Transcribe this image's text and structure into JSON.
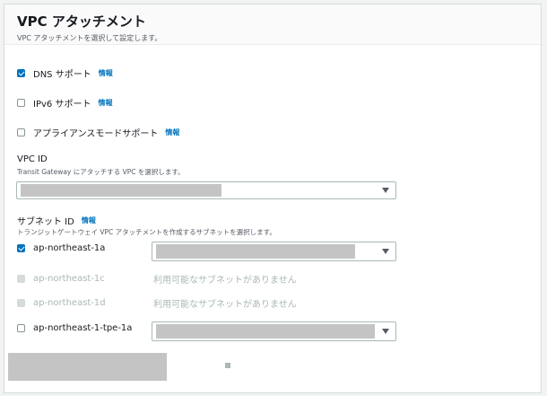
{
  "header": {
    "title": "VPC アタッチメント",
    "description": "VPC アタッチメントを選択して設定します。"
  },
  "options": [
    {
      "label": "DNS サポート",
      "info": "情報",
      "checked": true
    },
    {
      "label": "IPv6 サポート",
      "info": "情報",
      "checked": false
    },
    {
      "label": "アプライアンスモードサポート",
      "info": "情報",
      "checked": false
    }
  ],
  "vpc": {
    "label": "VPC ID",
    "description": "Transit Gateway にアタッチする VPC を選択します。"
  },
  "subnet": {
    "label": "サブネット ID",
    "info": "情報",
    "description": "トランジットゲートウェイ VPC アタッチメントを作成するサブネットを選択します。",
    "zones": [
      {
        "name": "ap-northeast-1a",
        "checked": true,
        "available": true
      },
      {
        "name": "ap-northeast-1c",
        "checked": false,
        "available": false,
        "message": "利用可能なサブネットがありません"
      },
      {
        "name": "ap-northeast-1d",
        "checked": false,
        "available": false,
        "message": "利用可能なサブネットがありません"
      },
      {
        "name": "ap-northeast-1-tpe-1a",
        "checked": false,
        "available": true
      }
    ]
  },
  "colors": {
    "accent": "#0073bb",
    "disabled_text": "#aab7b8",
    "border": "#d5dbdb"
  },
  "icons": {
    "dropdown": "caret-down-icon",
    "checkbox_checked": "checkmark-icon"
  }
}
